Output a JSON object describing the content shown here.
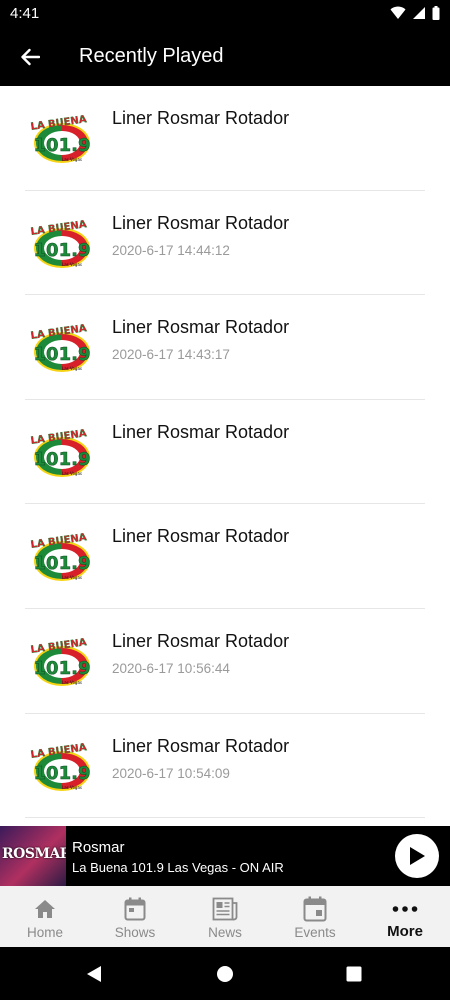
{
  "status_bar": {
    "time": "4:41"
  },
  "app_bar": {
    "title": "Recently Played"
  },
  "logo": {
    "top": "LA BUENA",
    "number": "101.9",
    "sub": "Las Vegas"
  },
  "recently_played": [
    {
      "title": "Liner Rosmar Rotador",
      "time": ""
    },
    {
      "title": "Liner Rosmar Rotador",
      "time": "2020-6-17 14:44:12"
    },
    {
      "title": "Liner Rosmar Rotador",
      "time": "2020-6-17 14:43:17"
    },
    {
      "title": "Liner Rosmar Rotador",
      "time": ""
    },
    {
      "title": "Liner Rosmar Rotador",
      "time": ""
    },
    {
      "title": "Liner Rosmar Rotador",
      "time": "2020-6-17 10:56:44"
    },
    {
      "title": "Liner Rosmar Rotador",
      "time": "2020-6-17 10:54:09"
    },
    {
      "title": "",
      "time": ""
    }
  ],
  "player": {
    "art_word": "ROSMAR",
    "title": "Rosmar",
    "subtitle": "La Buena 101.9 Las Vegas - ON AIR"
  },
  "tabs": [
    {
      "label": "Home",
      "icon": "home-icon"
    },
    {
      "label": "Shows",
      "icon": "calendar-icon"
    },
    {
      "label": "News",
      "icon": "newspaper-icon"
    },
    {
      "label": "Events",
      "icon": "event-icon"
    },
    {
      "label": "More",
      "icon": "more-icon",
      "active": true
    }
  ],
  "colors": {
    "background": "#ffffff",
    "bars": "#000000",
    "tab_inactive": "#8a8a8a",
    "tab_active": "#111111",
    "timestamp": "#9a9a9a",
    "logo_red": "#d8202a",
    "logo_green": "#1d8a3a",
    "logo_yellow": "#f5d312"
  }
}
